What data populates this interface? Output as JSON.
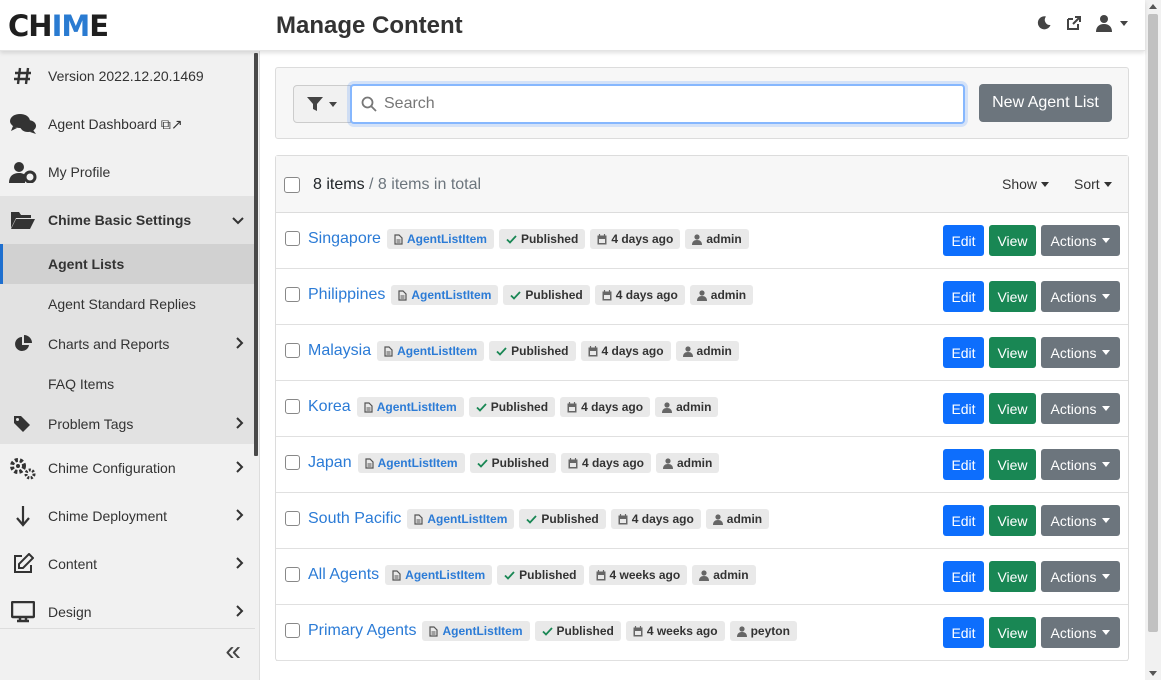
{
  "app": {
    "logo_part1": "CH",
    "logo_part2": "IM",
    "logo_part3": "E",
    "page_title": "Manage Content"
  },
  "header_icons": [
    "moon-icon",
    "external-link-icon",
    "user-icon",
    "chevron-down-icon"
  ],
  "sidebar": {
    "items": [
      {
        "label": "Version 2022.12.20.1469",
        "icon": "hash-icon"
      },
      {
        "label": "Agent Dashboard ⧉↗",
        "icon": "chat-icon"
      },
      {
        "label": "My Profile",
        "icon": "user-cog-icon"
      },
      {
        "label": "Chime Basic Settings",
        "icon": "folder-open-icon"
      },
      {
        "label": "Agent Lists"
      },
      {
        "label": "Agent Standard Replies"
      },
      {
        "label": "Charts and Reports",
        "icon": "pie-chart-icon"
      },
      {
        "label": "FAQ Items"
      },
      {
        "label": "Problem Tags",
        "icon": "tags-icon"
      },
      {
        "label": "Chime Configuration",
        "icon": "gears-icon"
      },
      {
        "label": "Chime Deployment",
        "icon": "arrow-down-icon"
      },
      {
        "label": "Content",
        "icon": "edit-icon"
      },
      {
        "label": "Design",
        "icon": "monitor-icon"
      }
    ],
    "collapse_label": "«"
  },
  "search": {
    "placeholder": "Search",
    "new_button": "New Agent List"
  },
  "list": {
    "count": "8 items",
    "total": " / 8 items in total",
    "show_label": "Show",
    "sort_label": "Sort",
    "rows": [
      {
        "title": "Singapore",
        "type": "AgentListItem",
        "status": "Published",
        "date": "4 days ago",
        "author": "admin"
      },
      {
        "title": "Philippines",
        "type": "AgentListItem",
        "status": "Published",
        "date": "4 days ago",
        "author": "admin"
      },
      {
        "title": "Malaysia",
        "type": "AgentListItem",
        "status": "Published",
        "date": "4 days ago",
        "author": "admin"
      },
      {
        "title": "Korea",
        "type": "AgentListItem",
        "status": "Published",
        "date": "4 days ago",
        "author": "admin"
      },
      {
        "title": "Japan",
        "type": "AgentListItem",
        "status": "Published",
        "date": "4 days ago",
        "author": "admin"
      },
      {
        "title": "South Pacific",
        "type": "AgentListItem",
        "status": "Published",
        "date": "4 days ago",
        "author": "admin"
      },
      {
        "title": "All Agents",
        "type": "AgentListItem",
        "status": "Published",
        "date": "4 weeks ago",
        "author": "admin"
      },
      {
        "title": "Primary Agents",
        "type": "AgentListItem",
        "status": "Published",
        "date": "4 weeks ago",
        "author": "peyton"
      }
    ],
    "edit_label": "Edit",
    "view_label": "View",
    "actions_label": "Actions"
  },
  "colors": {
    "primary": "#0d6efd",
    "success": "#198754",
    "secondary": "#6c757d",
    "link": "#2b7bd6"
  }
}
